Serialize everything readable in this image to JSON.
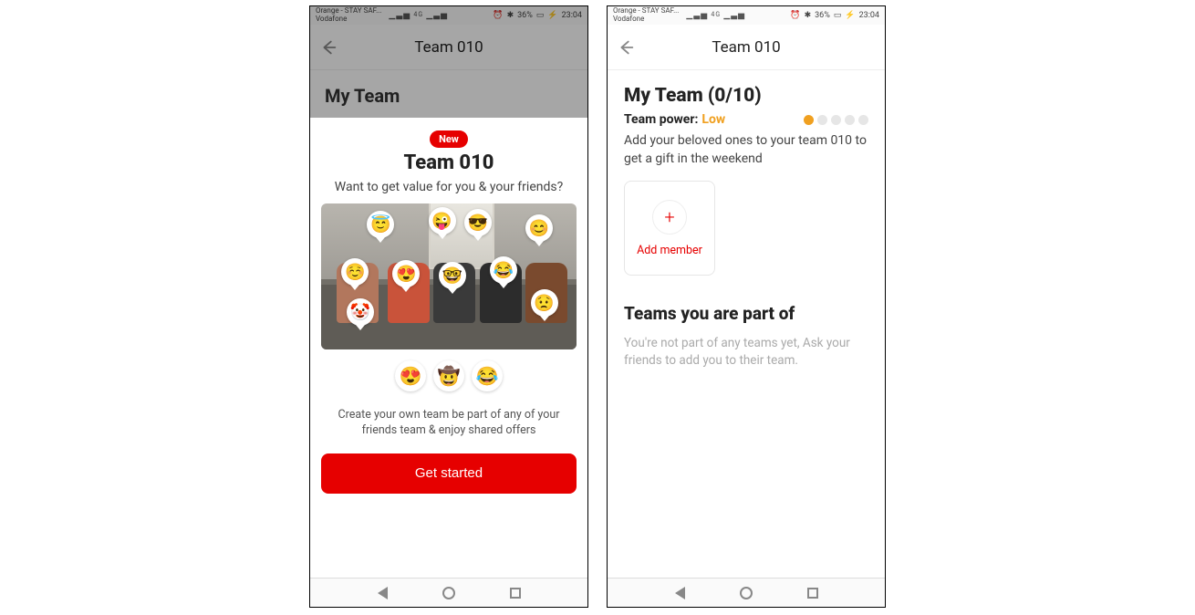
{
  "status": {
    "carrier1": "Orange - STAY SAF...",
    "carrier2": "Vodafone",
    "signal_glyph": "▁▃▅",
    "net_glyph": "4G",
    "alarm_glyph": "⏰",
    "bt_glyph": "✱",
    "battery_pct": "36%",
    "battery_glyph": "▭",
    "charge_glyph": "⚡",
    "time": "23:04"
  },
  "left": {
    "header_title": "Team 010",
    "dim_title": "My Team",
    "badge": "New",
    "sheet_title": "Team 010",
    "subtitle": "Want to get value for you & your friends?",
    "bubbles": {
      "halo": "😇",
      "tongue": "😜",
      "cool": "😎",
      "smile": "😊",
      "blush": "☺️",
      "heart": "😍",
      "nerd": "🤓",
      "lol": "😂",
      "clown": "🤡",
      "worry": "😟"
    },
    "emoji_row": [
      "😍",
      "🤠",
      "😂"
    ],
    "body": "Create your own team be part of any of your friends team & enjoy shared offers",
    "cta": "Get started"
  },
  "right": {
    "header_title": "Team 010",
    "my_team_heading": "My Team (0/10)",
    "power_label": "Team power:",
    "power_value": "Low",
    "power_dots_on": 1,
    "power_dots_total": 5,
    "description": "Add your beloved ones to your team 010 to get a gift in the weekend",
    "add_member_label": "Add member",
    "teams_heading": "Teams you are part of",
    "empty_text": "You're not part of any teams yet, Ask your friends to add you to their team."
  }
}
